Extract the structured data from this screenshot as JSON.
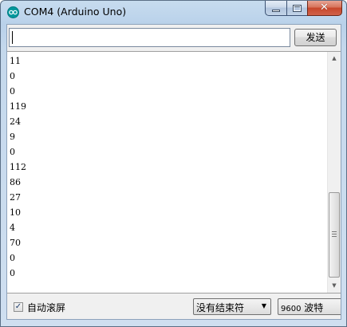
{
  "window": {
    "title": "COM4 (Arduino Uno)",
    "icon": "arduino-icon",
    "caption_buttons": [
      "minimize-icon",
      "maximize-icon",
      "close-icon"
    ],
    "close_glyph": "✕"
  },
  "input": {
    "value": "",
    "send_label": "发送"
  },
  "output": {
    "lines": [
      "11",
      "0",
      "0",
      "119",
      "24",
      "9",
      "0",
      "112",
      "86",
      "27",
      "10",
      "4",
      "70",
      "0",
      "0"
    ],
    "scroll_up_glyph": "▲",
    "scroll_down_glyph": "▼"
  },
  "status": {
    "autoscroll_label": "自动滚屏",
    "autoscroll_checked": true,
    "checkmark": "✓",
    "line_ending": "没有结束符",
    "baud_value": "9600",
    "baud_unit": "波特",
    "dropdown_glyph": "▼"
  },
  "colors": {
    "titlebar": "#b9d1ea",
    "close_button": "#c7472a",
    "arduino_teal": "#00979c"
  }
}
